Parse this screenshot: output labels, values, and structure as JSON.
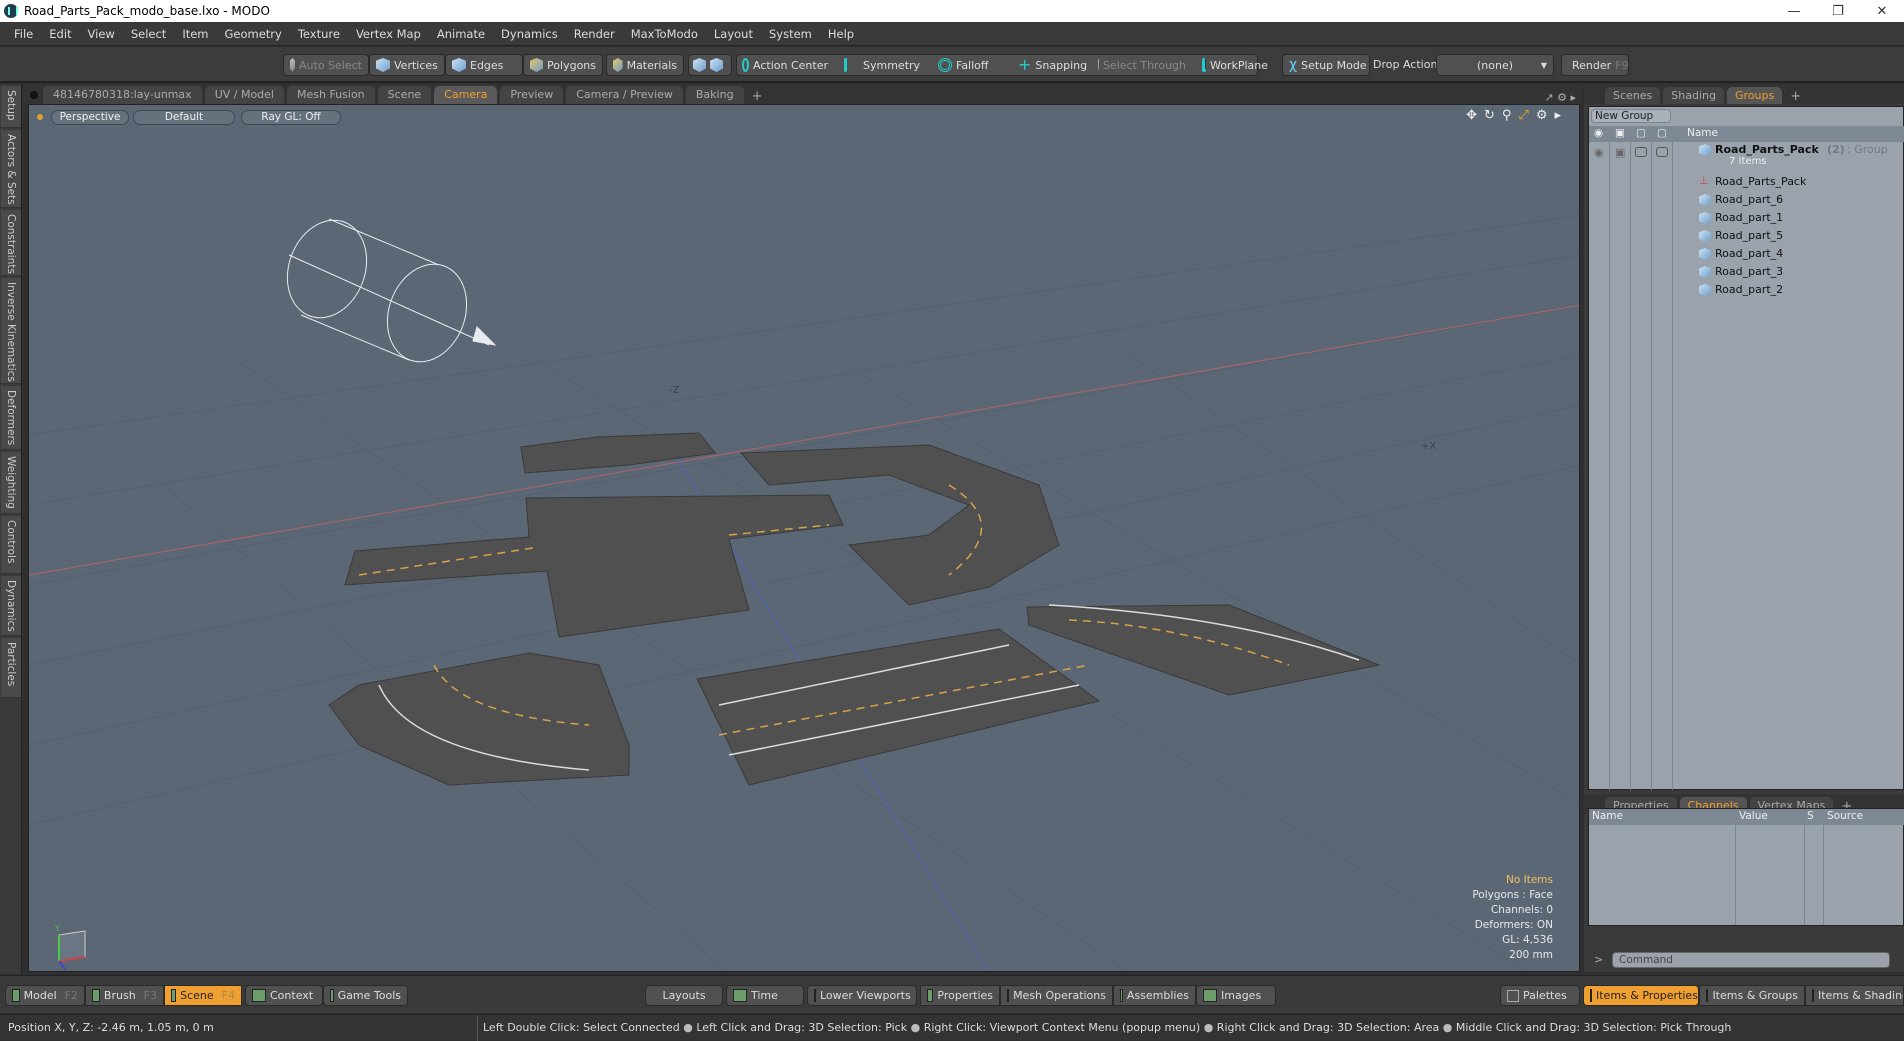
{
  "window": {
    "title": "Road_Parts_Pack_modo_base.lxo - MODO",
    "controls": [
      "minimize",
      "restore",
      "close"
    ]
  },
  "menu": [
    "File",
    "Edit",
    "View",
    "Select",
    "Item",
    "Geometry",
    "Texture",
    "Vertex Map",
    "Animate",
    "Dynamics",
    "Render",
    "MaxToModo",
    "Layout",
    "System",
    "Help"
  ],
  "toolbar": {
    "auto_select": "Auto Select",
    "vertices": "Vertices",
    "edges": "Edges",
    "polygons": "Polygons",
    "materials": "Materials",
    "action_center": "Action Center",
    "symmetry": "Symmetry",
    "falloff": "Falloff",
    "snapping": "Snapping",
    "select_through": "Select Through",
    "workplane": "WorkPlane",
    "setup_mode": "Setup Mode",
    "drop_action_label": "Drop Action",
    "drop_action_value": "(none)",
    "render": "Render",
    "render_key": "F9"
  },
  "left_tabs": [
    "Setup",
    "Actors & Sets",
    "Constraints",
    "Inverse Kinematics",
    "Deformers",
    "Weighting",
    "Controls",
    "Dynamics",
    "Particles"
  ],
  "viewport_tabs": [
    {
      "label": "48146780318:lay-unmax",
      "active": false
    },
    {
      "label": "UV / Model",
      "active": false
    },
    {
      "label": "Mesh Fusion",
      "active": false
    },
    {
      "label": "Scene",
      "active": false
    },
    {
      "label": "Camera",
      "active": true
    },
    {
      "label": "Preview",
      "active": false
    },
    {
      "label": "Camera / Preview",
      "active": false
    },
    {
      "label": "Baking",
      "active": false
    }
  ],
  "viewport": {
    "view_mode": "Perspective",
    "shading": "Default",
    "raygl": "Ray GL: Off",
    "axis_labels": {
      "neg_z": "-Z",
      "pos_x": "+X",
      "gizmo_y": "Y"
    },
    "hud": {
      "selection": "No Items",
      "mode": "Polygons : Face",
      "channels": "Channels: 0",
      "deformers": "Deformers: ON",
      "gl": "GL: 4,536",
      "grid": "200 mm"
    },
    "nav_icons": [
      "move-icon",
      "rotate-icon",
      "zoom-icon",
      "fit-icon",
      "settings-icon",
      "more-icon"
    ]
  },
  "right_top_tabs": [
    {
      "label": "Scenes",
      "active": false
    },
    {
      "label": "Shading",
      "active": false
    },
    {
      "label": "Groups",
      "active": true
    }
  ],
  "groups": {
    "new_group": "New Group",
    "name_col": "Name",
    "root": {
      "name": "Road_Parts_Pack",
      "count": "(2)",
      "type": ": Group",
      "items_label": "7 Items"
    },
    "children": [
      "Road_Parts_Pack",
      "Road_part_6",
      "Road_part_1",
      "Road_part_5",
      "Road_part_4",
      "Road_part_3",
      "Road_part_2"
    ]
  },
  "right_bottom_tabs": [
    {
      "label": "Properties",
      "active": false
    },
    {
      "label": "Channels",
      "active": true
    },
    {
      "label": "Vertex Maps",
      "active": false
    }
  ],
  "channels": {
    "columns": [
      "Name",
      "Value",
      "S",
      "Source"
    ]
  },
  "command": {
    "placeholder": "Command",
    "prompt": ">"
  },
  "bottom_bar": {
    "left": [
      {
        "label": "Model",
        "key": "F2",
        "active": false
      },
      {
        "label": "Brush",
        "key": "F3",
        "active": false
      },
      {
        "label": "Scene",
        "key": "F4",
        "active": true
      },
      {
        "label": "Context",
        "key": "",
        "active": false
      },
      {
        "label": "Game Tools",
        "key": "",
        "active": false
      }
    ],
    "middle": [
      "Layouts",
      "Time",
      "Lower Viewports",
      "Properties",
      "Mesh Operations",
      "Assemblies",
      "Images"
    ],
    "right": [
      {
        "label": "Palettes",
        "active": false
      },
      {
        "label": "Items & Properties",
        "active": true
      },
      {
        "label": "Items & Groups",
        "active": false
      },
      {
        "label": "Items & Shading",
        "active": false
      }
    ]
  },
  "status": {
    "position": "Position X, Y, Z:   -2.46 m, 1.05 m, 0 m",
    "hints": [
      "Left Double Click: Select Connected",
      "Left Click and Drag: 3D Selection: Pick",
      "Right Click: Viewport Context Menu (popup menu)",
      "Right Click and Drag: 3D Selection: Area",
      "Middle Click and Drag: 3D Selection: Pick Through"
    ]
  },
  "colors": {
    "accent": "#f0a030",
    "viewport_bg": "#5b6775",
    "panel_bg": "#9aa2ac"
  }
}
